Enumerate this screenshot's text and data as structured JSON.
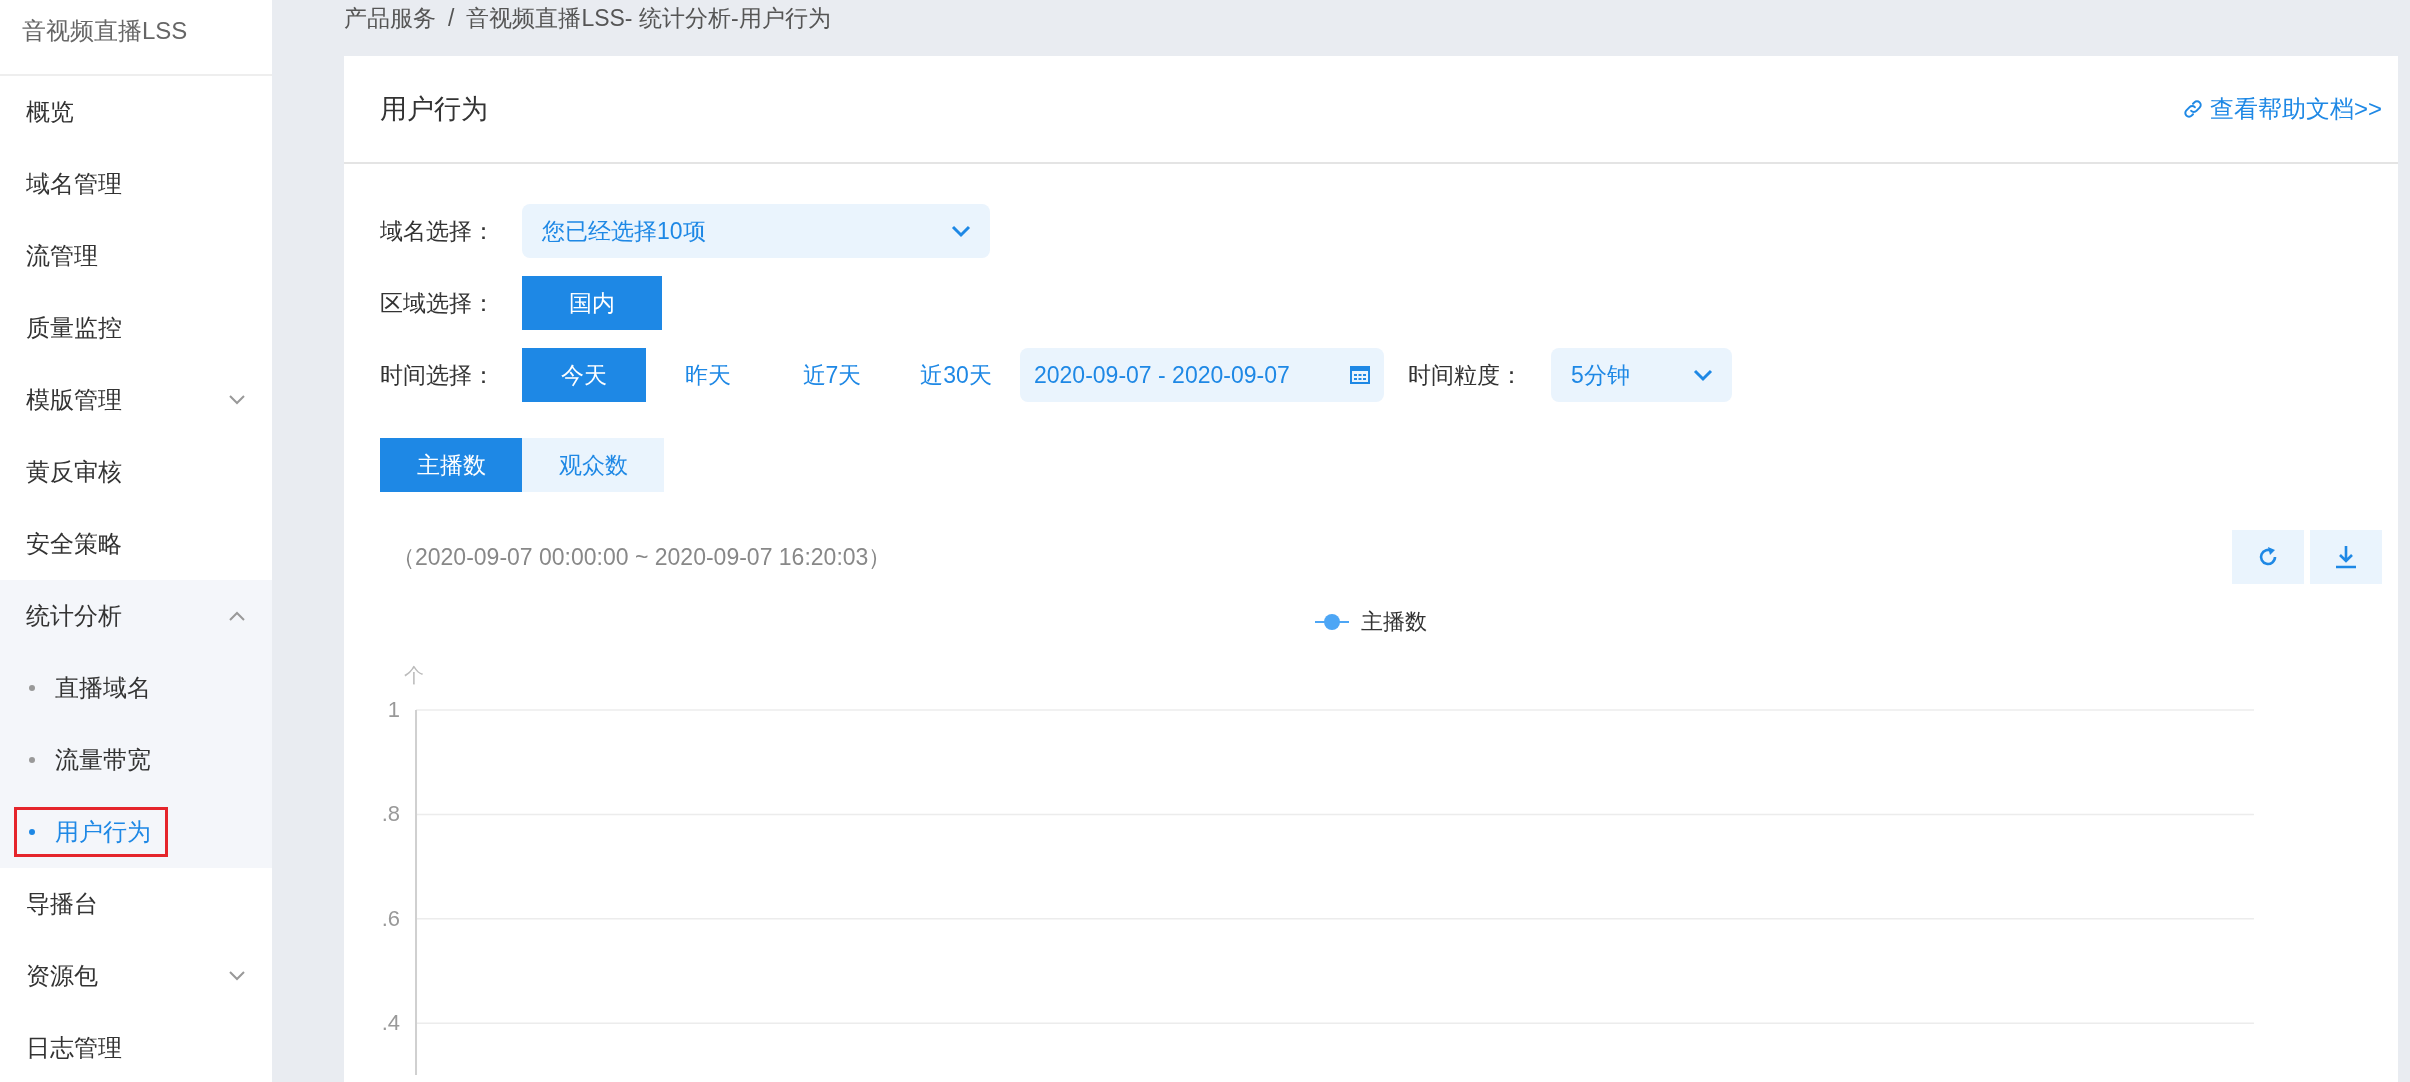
{
  "sidebar": {
    "title": "音视频直播LSS",
    "items": [
      {
        "label": "概览",
        "kind": "item"
      },
      {
        "label": "域名管理",
        "kind": "item"
      },
      {
        "label": "流管理",
        "kind": "item"
      },
      {
        "label": "质量监控",
        "kind": "item"
      },
      {
        "label": "模版管理",
        "kind": "group",
        "expanded": false
      },
      {
        "label": "黄反审核",
        "kind": "item"
      },
      {
        "label": "安全策略",
        "kind": "item"
      },
      {
        "label": "统计分析",
        "kind": "group",
        "expanded": true,
        "children": [
          {
            "label": "直播域名",
            "selected": false,
            "highlighted": false
          },
          {
            "label": "流量带宽",
            "selected": false,
            "highlighted": false
          },
          {
            "label": "用户行为",
            "selected": true,
            "highlighted": true
          }
        ]
      },
      {
        "label": "导播台",
        "kind": "item"
      },
      {
        "label": "资源包",
        "kind": "group",
        "expanded": false
      },
      {
        "label": "日志管理",
        "kind": "item"
      }
    ]
  },
  "breadcrumb": [
    "产品服务",
    "/",
    "音视频直播LSS- 统计分析-用户行为"
  ],
  "page": {
    "title": "用户行为",
    "help_link": "查看帮助文档>>"
  },
  "filters": {
    "domain": {
      "label": "域名选择：",
      "value": "您已经选择10项"
    },
    "region": {
      "label": "区域选择：",
      "options": [
        {
          "label": "国内",
          "selected": true
        }
      ]
    },
    "time": {
      "label": "时间选择：",
      "options": [
        {
          "label": "今天",
          "selected": true
        },
        {
          "label": "昨天",
          "selected": false
        },
        {
          "label": "近7天",
          "selected": false
        },
        {
          "label": "近30天",
          "selected": false
        }
      ],
      "date_range": "2020-09-07 - 2020-09-07"
    },
    "granularity": {
      "label": "时间粒度：",
      "value": "5分钟"
    }
  },
  "metric_tabs": [
    {
      "label": "主播数",
      "selected": true
    },
    {
      "label": "观众数",
      "selected": false
    }
  ],
  "time_span": "（2020-09-07 00:00:00 ~ 2020-09-07 16:20:03）",
  "chart": {
    "chart_data": {
      "type": "line",
      "grid": true,
      "ylabel": "个",
      "ylim": [
        0.3,
        1
      ],
      "yticks": [
        {
          "value": 1,
          "label": "1"
        },
        {
          "value": 0.8,
          "label": ".8"
        },
        {
          "value": 0.6,
          "label": ".6"
        },
        {
          "value": 0.4,
          "label": ".4"
        }
      ],
      "series": [
        {
          "name": "主播数",
          "color": "#4da6f5"
        }
      ]
    }
  }
}
